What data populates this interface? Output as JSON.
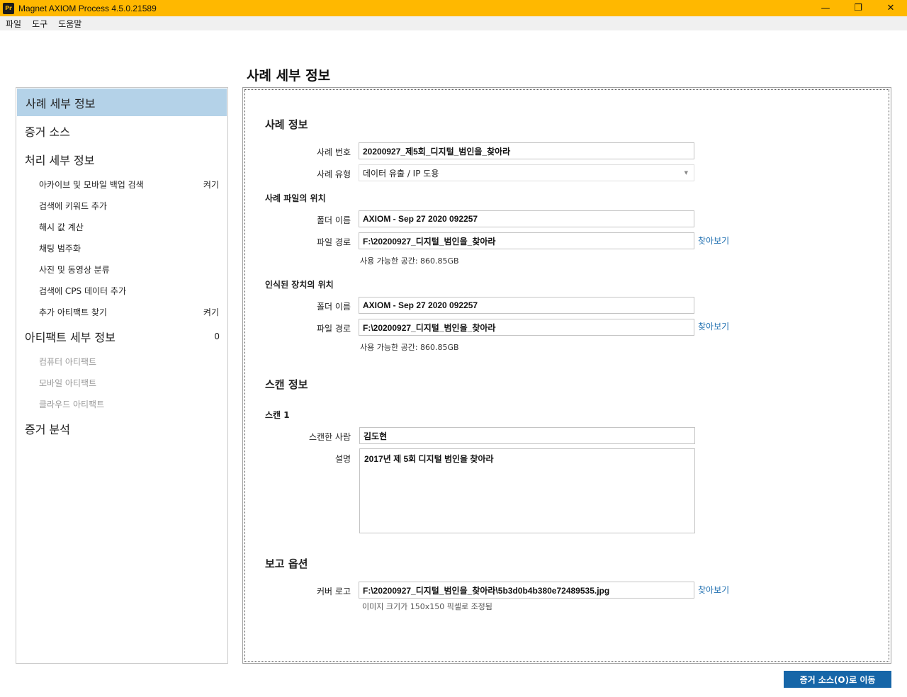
{
  "window": {
    "title": "Magnet AXIOM Process 4.5.0.21589",
    "icon_text": "Pr",
    "minimize_glyph": "—",
    "restore_glyph": "❐",
    "close_glyph": "✕"
  },
  "menu": [
    "파일",
    "도구",
    "도움말"
  ],
  "page_title": "사례 세부 정보",
  "sidebar": {
    "items": [
      {
        "label": "사례 세부 정보",
        "level": "top",
        "active": true,
        "badge": ""
      },
      {
        "label": "증거 소스",
        "level": "top",
        "badge": ""
      },
      {
        "label": "처리 세부 정보",
        "level": "top",
        "badge": ""
      },
      {
        "label": "아카이브 및 모바일 백업 검색",
        "level": "sub",
        "badge": "켜기"
      },
      {
        "label": "검색에 키워드 추가",
        "level": "sub",
        "badge": ""
      },
      {
        "label": "해시 값 계산",
        "level": "sub",
        "badge": ""
      },
      {
        "label": "채팅 범주화",
        "level": "sub",
        "badge": ""
      },
      {
        "label": "사진 및 동영상 분류",
        "level": "sub",
        "badge": ""
      },
      {
        "label": "검색에 CPS 데이터 추가",
        "level": "sub",
        "badge": ""
      },
      {
        "label": "추가 아티팩트 찾기",
        "level": "sub",
        "badge": "켜기"
      },
      {
        "label": "아티팩트 세부 정보",
        "level": "top",
        "badge": "0"
      },
      {
        "label": "컴퓨터 아티팩트",
        "level": "sub",
        "dim": true,
        "badge": ""
      },
      {
        "label": "모바일 아티팩트",
        "level": "sub",
        "dim": true,
        "badge": ""
      },
      {
        "label": "클라우드 아티팩트",
        "level": "sub",
        "dim": true,
        "badge": ""
      },
      {
        "label": "증거 분석",
        "level": "top",
        "badge": ""
      }
    ]
  },
  "case_info": {
    "heading": "사례 정보",
    "case_number_label": "사례 번호",
    "case_number": "20200927_제5회_디지털_범인을_찾아라",
    "case_type_label": "사례 유형",
    "case_type": "데이터 유출 / IP 도용"
  },
  "case_file_location": {
    "heading": "사례 파일의 위치",
    "folder_label": "폴더 이름",
    "folder": "AXIOM - Sep 27 2020 092257",
    "path_label": "파일 경로",
    "path": "F:\\20200927_디지털_범인을_찾아라",
    "browse": "찾아보기",
    "free_space": "사용 가능한 공간: 860.85GB"
  },
  "acquired_location": {
    "heading": "인식된 장치의 위치",
    "folder_label": "폴더 이름",
    "folder": "AXIOM - Sep 27 2020 092257",
    "path_label": "파일 경로",
    "path": "F:\\20200927_디지털_범인을_찾아라",
    "browse": "찾아보기",
    "free_space": "사용 가능한 공간: 860.85GB"
  },
  "scan_info": {
    "heading": "스캔 정보",
    "scan_title": "스캔 1",
    "scanned_by_label": "스캔한 사람",
    "scanned_by": "김도현",
    "description_label": "설명",
    "description": "2017년 제 5회 디지털 범인을 찾아라"
  },
  "report_options": {
    "heading": "보고 옵션",
    "cover_logo_label": "커버 로고",
    "cover_logo": "F:\\20200927_디지털_범인을_찾아라\\5b3d0b4b380e72489535.jpg",
    "browse": "찾아보기",
    "hint": "이미지 크기가 150x150 픽셀로 조정됨"
  },
  "footer": {
    "next_button": "증거 소스(O)로 이동"
  }
}
